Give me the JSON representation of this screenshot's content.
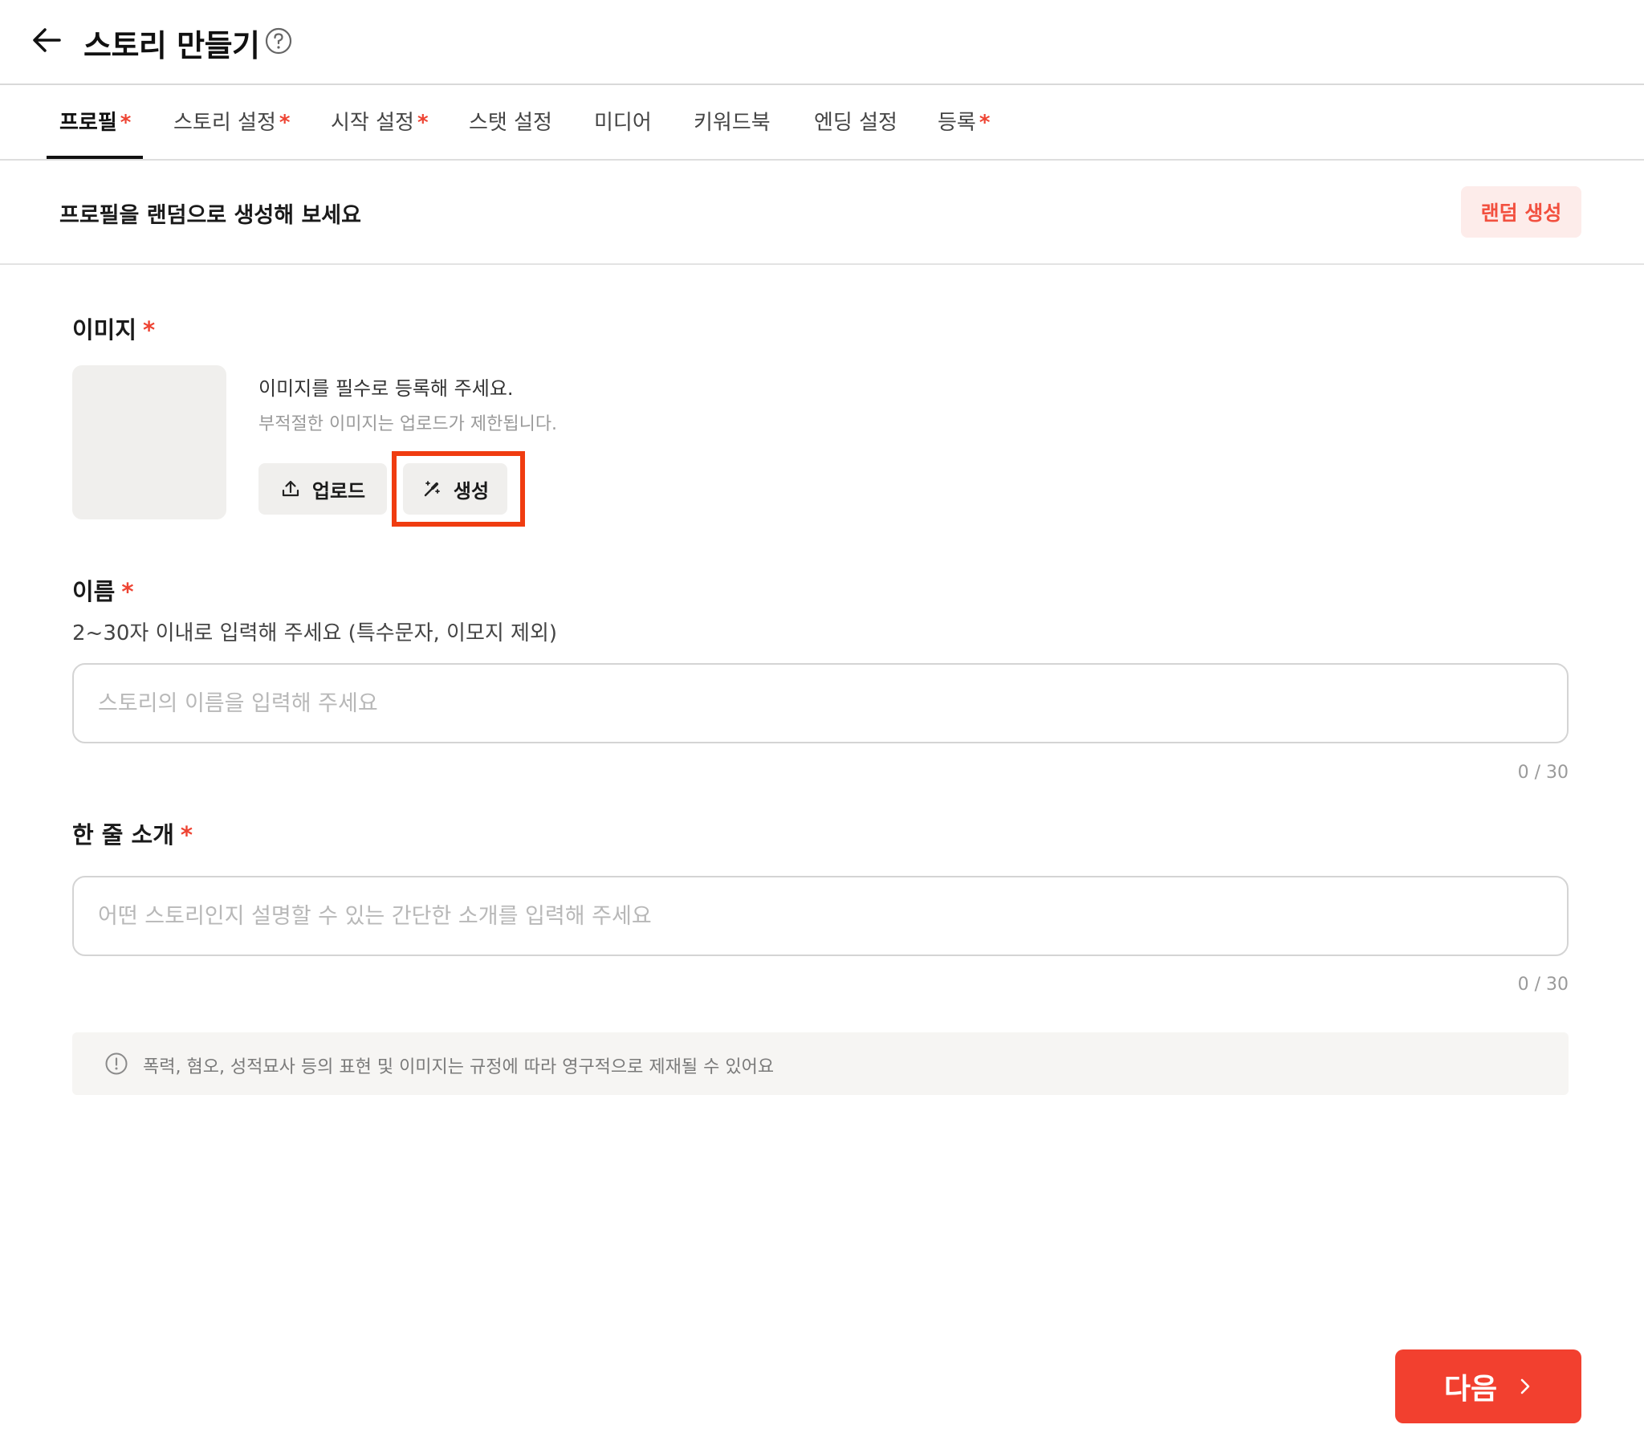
{
  "header": {
    "title": "스토리 만들기"
  },
  "tabs": [
    {
      "label": "프로필",
      "required": true,
      "active": true
    },
    {
      "label": "스토리 설정",
      "required": true
    },
    {
      "label": "시작 설정",
      "required": true
    },
    {
      "label": "스탯 설정",
      "required": false
    },
    {
      "label": "미디어",
      "required": false
    },
    {
      "label": "키워드북",
      "required": false
    },
    {
      "label": "엔딩 설정",
      "required": false
    },
    {
      "label": "등록",
      "required": true
    }
  ],
  "required_mark": "*",
  "random": {
    "prompt": "프로필을 랜덤으로 생성해 보세요",
    "button_label": "랜덤 생성"
  },
  "image": {
    "label": "이미지",
    "help_primary": "이미지를 필수로 등록해 주세요.",
    "help_secondary": "부적절한 이미지는 업로드가 제한됩니다.",
    "upload_label": "업로드",
    "generate_label": "생성"
  },
  "name": {
    "label": "이름",
    "description": "2~30자 이내로 입력해 주세요 (특수문자, 이모지 제외)",
    "placeholder": "스토리의 이름을 입력해 주세요",
    "value": "",
    "counter": "0 / 30"
  },
  "intro": {
    "label": "한 줄 소개",
    "placeholder": "어떤 스토리인지 설명할 수 있는 간단한 소개를 입력해 주세요",
    "value": "",
    "counter": "0 / 30"
  },
  "notice": {
    "text": "폭력, 혐오, 성적묘사 등의 표현 및 이미지는 규정에 따라 영구적으로 제재될 수 있어요"
  },
  "footer": {
    "next_label": "다음"
  },
  "colors": {
    "accent": "#f2402f",
    "required": "#ee4433",
    "highlight": "#f03c10"
  }
}
